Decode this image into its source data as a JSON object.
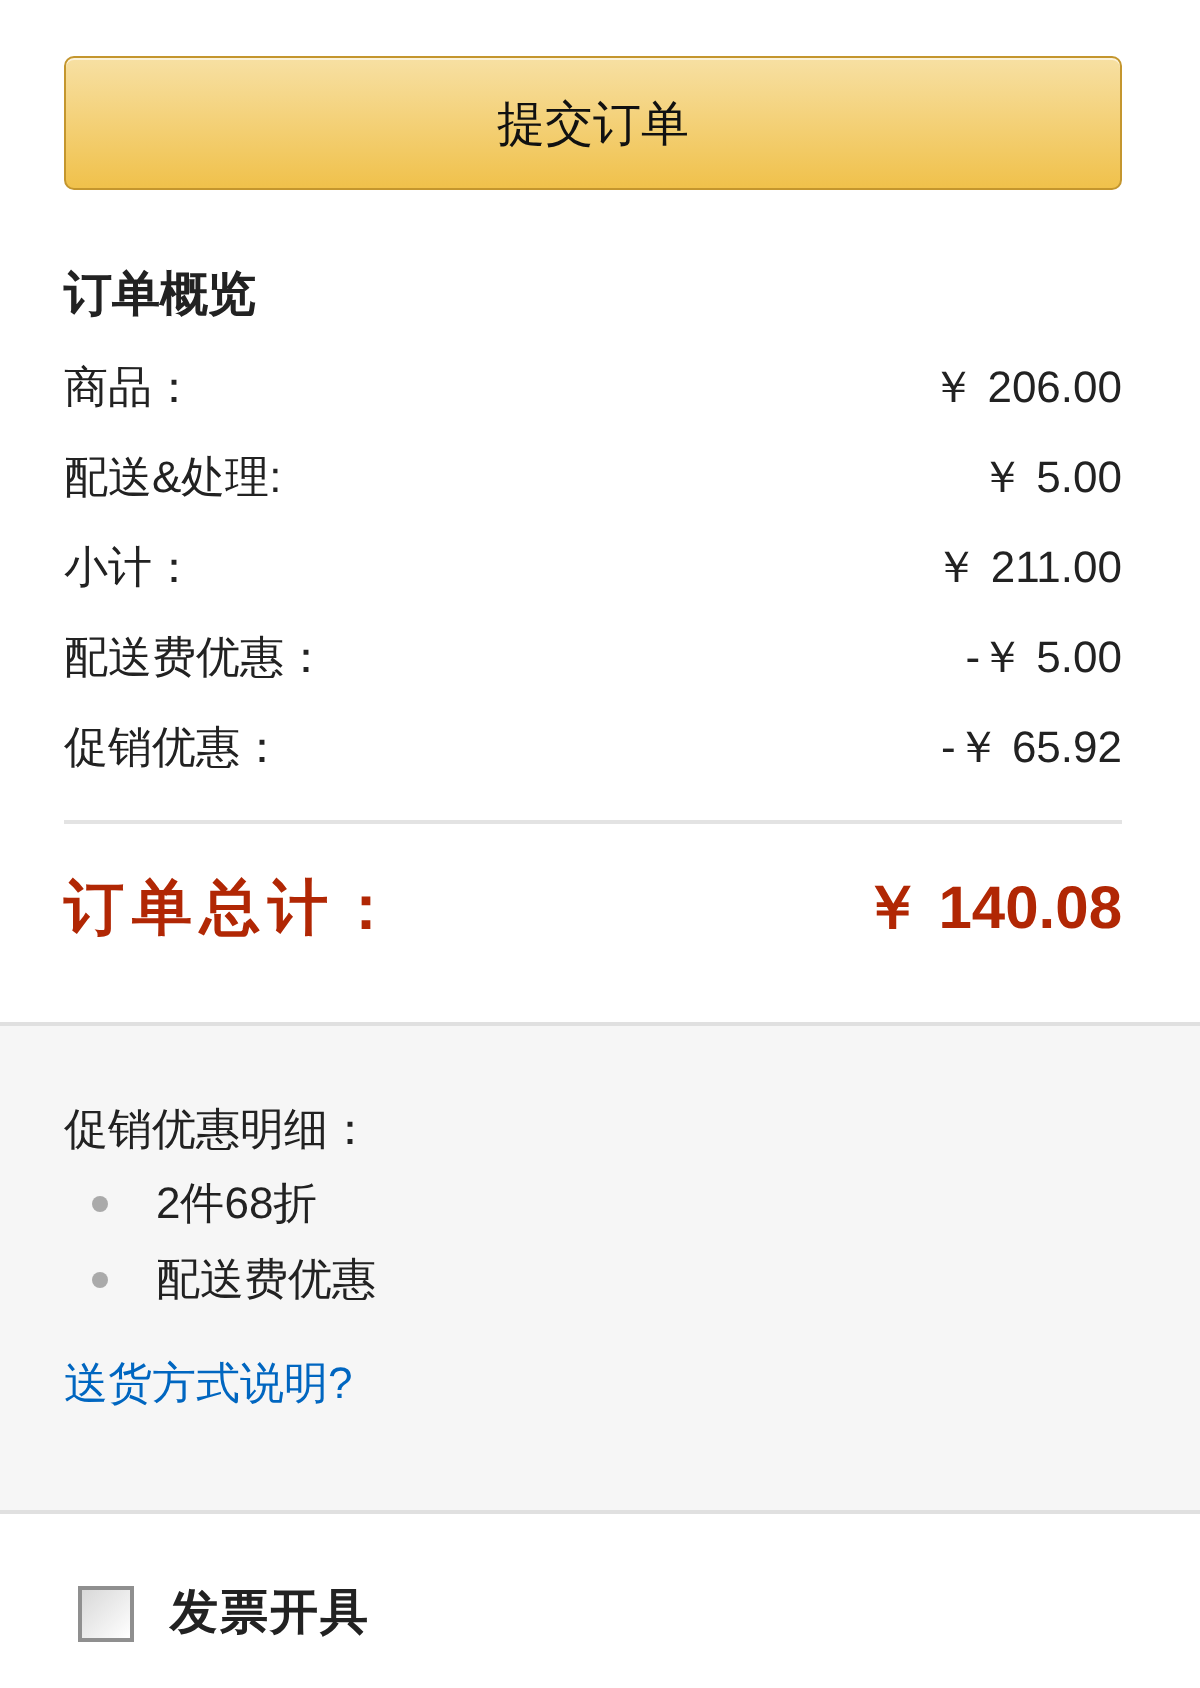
{
  "submit_button": {
    "label": "提交订单"
  },
  "summary": {
    "title": "订单概览",
    "rows": [
      {
        "label": "商品：",
        "amount": "￥ 206.00"
      },
      {
        "label": "配送&处理:",
        "amount": "￥ 5.00"
      },
      {
        "label": "小计：",
        "amount": "￥ 211.00"
      },
      {
        "label": "配送费优惠：",
        "amount": "-￥ 5.00"
      },
      {
        "label": "促销优惠：",
        "amount": "-￥ 65.92"
      }
    ],
    "total": {
      "label": "订单总计：",
      "amount": "￥ 140.08"
    }
  },
  "promotions": {
    "title": "促销优惠明细：",
    "items": [
      "2件68折",
      "配送费优惠"
    ],
    "link": "送货方式说明?"
  },
  "invoice": {
    "label": "发票开具",
    "checked": false
  }
}
